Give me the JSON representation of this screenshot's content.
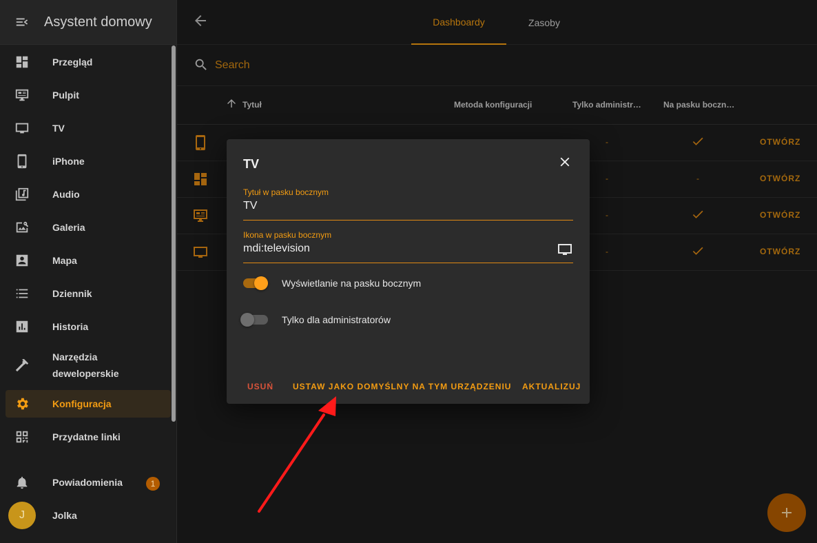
{
  "app_title": "Asystent domowy",
  "sidebar": {
    "items": [
      {
        "label": "Przegląd",
        "icon": "overview-icon"
      },
      {
        "label": "Pulpit",
        "icon": "desktop-icon"
      },
      {
        "label": "TV",
        "icon": "television-icon"
      },
      {
        "label": "iPhone",
        "icon": "phone-icon"
      },
      {
        "label": "Audio",
        "icon": "music-library-icon"
      },
      {
        "label": "Galeria",
        "icon": "image-search-icon"
      },
      {
        "label": "Mapa",
        "icon": "account-box-icon"
      },
      {
        "label": "Dziennik",
        "icon": "list-icon"
      },
      {
        "label": "Historia",
        "icon": "chart-box-icon"
      },
      {
        "label_line1": "Narzędzia",
        "label_line2": "deweloperskie",
        "icon": "hammer-icon"
      },
      {
        "label": "Konfiguracja",
        "icon": "gear-icon",
        "active": true
      },
      {
        "label": "Przydatne linki",
        "icon": "qrcode-icon"
      }
    ],
    "notifications_label": "Powiadomienia",
    "notifications_count": "1",
    "user_initial": "J",
    "user_name": "Jolka"
  },
  "tabs": [
    {
      "label": "Dashboardy",
      "active": true
    },
    {
      "label": "Zasoby",
      "active": false
    }
  ],
  "search": {
    "placeholder": "Search"
  },
  "table": {
    "headers": {
      "title": "Tytuł",
      "config_method": "Metoda konfiguracji",
      "admin_only": "Tylko administr…",
      "in_sidebar": "Na pasku boczn…"
    },
    "rows": [
      {
        "icon": "phone-icon",
        "admin_only": "-",
        "in_sidebar": "check",
        "action": "OTWÓRZ"
      },
      {
        "icon": "overview-icon",
        "admin_only": "-",
        "in_sidebar": "-",
        "action": "OTWÓRZ"
      },
      {
        "icon": "desktop-icon",
        "admin_only": "-",
        "in_sidebar": "check",
        "action": "OTWÓRZ"
      },
      {
        "icon": "television-icon",
        "admin_only": "-",
        "in_sidebar": "check",
        "action": "OTWÓRZ"
      }
    ]
  },
  "dialog": {
    "title": "TV",
    "sidebar_title_label": "Tytuł w pasku bocznym",
    "sidebar_title_value": "TV",
    "sidebar_icon_label": "Ikona w pasku bocznym",
    "sidebar_icon_value": "mdi:television",
    "show_in_sidebar_label": "Wyświetlanie na pasku bocznym",
    "show_in_sidebar": true,
    "admin_only_label": "Tylko dla administratorów",
    "admin_only": false,
    "delete_label": "USUŃ",
    "set_default_label": "USTAW JAKO DOMYŚLNY NA TYM URZĄDZENIU",
    "update_label": "AKTUALIZUJ"
  },
  "colors": {
    "accent": "#f39c12",
    "danger": "#d9533a",
    "annotation_arrow": "#ff1a1a"
  }
}
